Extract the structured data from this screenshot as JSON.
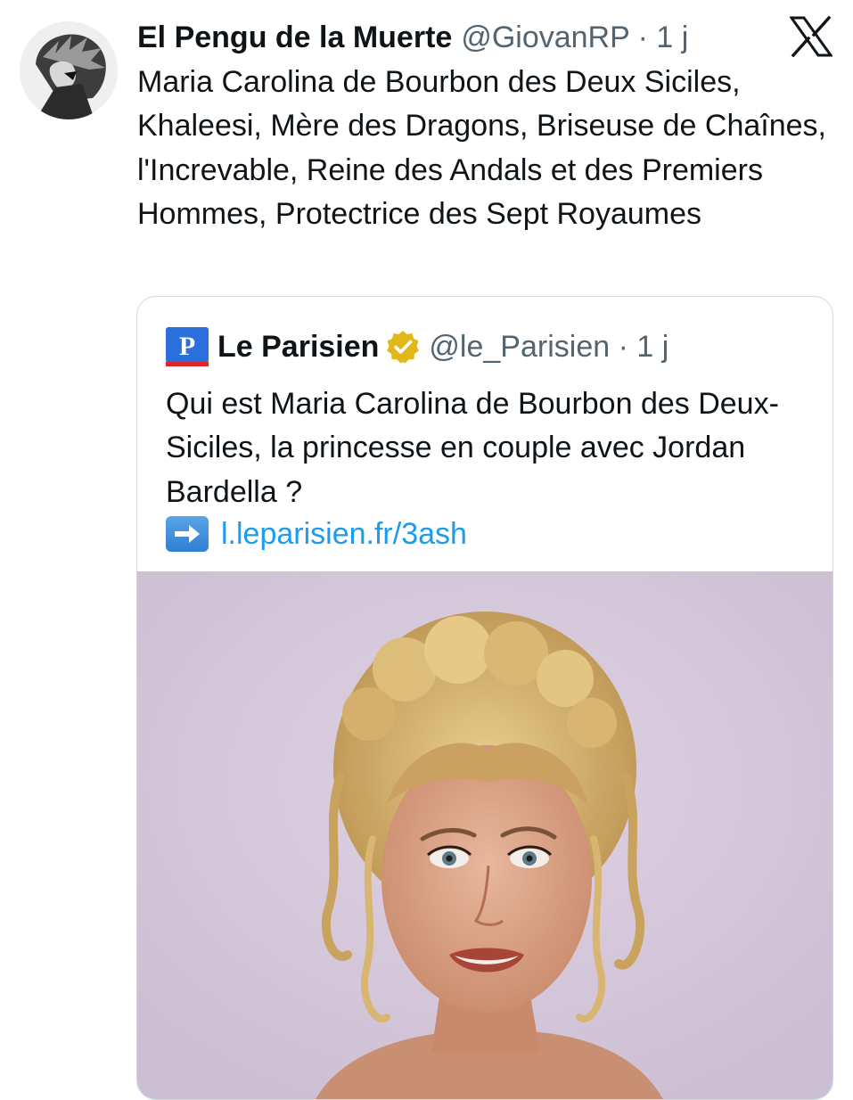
{
  "tweet": {
    "author_name": "El Pengu de la Muerte",
    "handle_meta": "@GiovanRP · 1 j",
    "text": "Maria Carolina de Bourbon des Deux Siciles, Khaleesi, Mère des Dragons, Briseuse de Chaînes, l'Increvable, Reine des Andals et des Premiers Hommes, Protectrice des Sept Royaumes",
    "platform_icon": "x-logo-icon",
    "avatar_icon": "profile-avatar-icon"
  },
  "quote": {
    "logo_letter": "P",
    "logo_icon": "le-parisien-logo-icon",
    "author_name": "Le Parisien",
    "verified_icon": "gold-verified-badge-icon",
    "handle_meta": "@le_Parisien · 1 j",
    "text": "Qui est Maria Carolina de Bourbon des Deux-Siciles, la princesse en couple avec Jordan Bardella ?",
    "arrow_icon": "right-arrow-emoji-icon",
    "link": "l.leparisien.fr/3ash",
    "image_icon": "article-photo-image"
  },
  "colors": {
    "text": "#0f1419",
    "secondary": "#536471",
    "link": "#1d9bf0",
    "border": "#cfd9de",
    "parisien_blue": "#2a6fdb",
    "parisien_red": "#e0242b",
    "verified_gold": "#e2b719",
    "photo_background": "#d7c9db"
  }
}
